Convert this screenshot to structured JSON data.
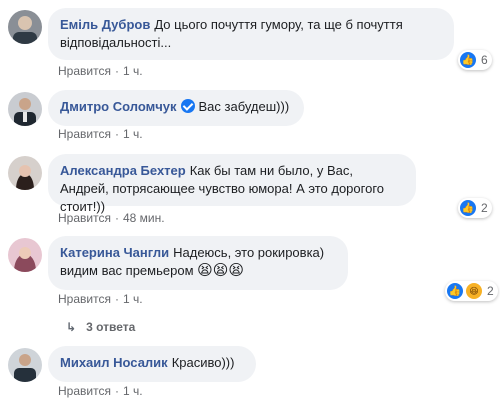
{
  "comments": [
    {
      "author": "Еміль Дубров",
      "text": "До цього почуття гумору, та ще б почуття відповідальності...",
      "like_label": "Нравится",
      "time": "1 ч.",
      "reaction_count": "6",
      "reaction_icons": [
        "like-icon"
      ]
    },
    {
      "author": "Дмитро Соломчук",
      "text": "Вас забудеш)))",
      "like_label": "Нравится",
      "time": "1 ч."
    },
    {
      "author": "Александра Бехтер",
      "text": "Как бы там ни было, у Вас, Андрей, потрясающее чувство юмора! А это дорогого стоит!))",
      "like_label": "Нравится",
      "time": "48 мин.",
      "reaction_count": "2",
      "reaction_icons": [
        "like-icon"
      ]
    },
    {
      "author": "Катерина Чангли",
      "text": "Надеюсь, это рокировка) видим вас премьером",
      "emoji": "😫😫😫",
      "like_label": "Нравится",
      "time": "1 ч.",
      "reaction_count": "2",
      "reaction_icons": [
        "like-icon",
        "haha-icon"
      ]
    },
    {
      "author": "Михаил Носалик",
      "text": "Красиво)))",
      "like_label": "Нравится",
      "time": "1 ч."
    }
  ],
  "replies_label": "3 ответа",
  "separator": "·",
  "colors": {
    "author": "#385898",
    "bubble": "#f0f2f5",
    "meta": "#65676b",
    "like": "#1877f2"
  }
}
